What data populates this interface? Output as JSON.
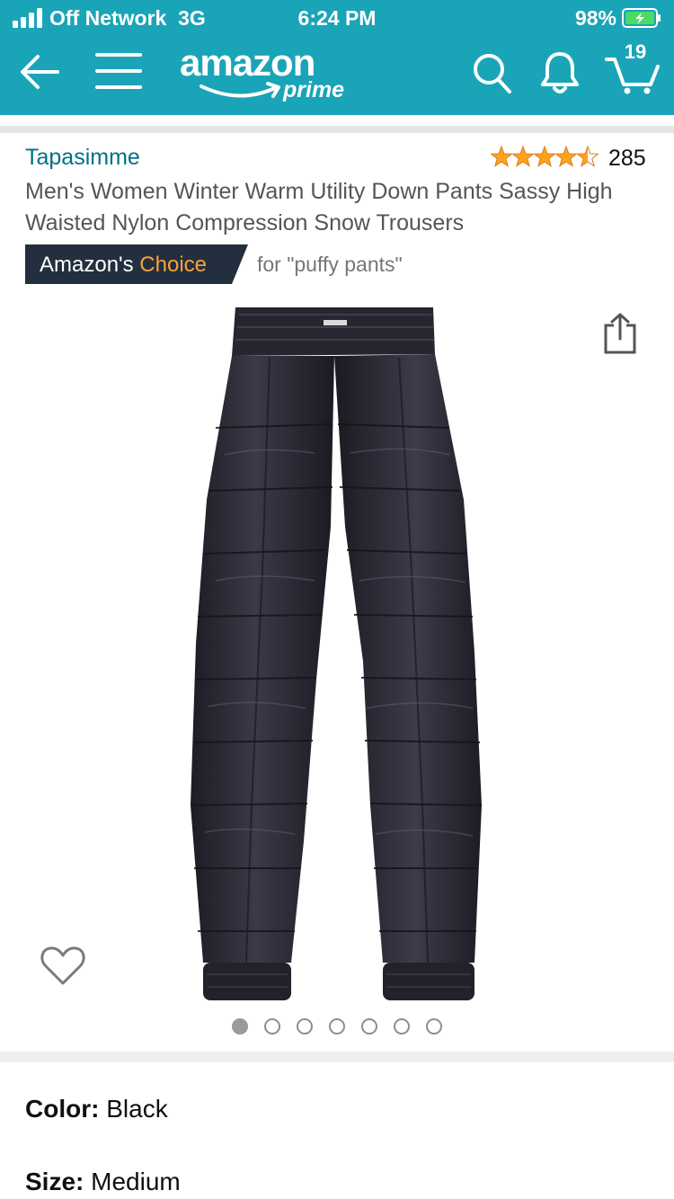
{
  "status_bar": {
    "network": "Off Network",
    "connection_type": "3G",
    "time": "6:24 PM",
    "battery_percent": "98%",
    "battery_charging": true,
    "signal_bars": 4
  },
  "header": {
    "logo_word": "amazon",
    "logo_sub": "prime",
    "cart_count": "19",
    "icons": [
      "back-arrow-icon",
      "menu-icon",
      "search-icon",
      "bell-icon",
      "cart-icon"
    ],
    "background_color": "#1aa4b8"
  },
  "product": {
    "brand": "Tapasimme",
    "rating_stars": 4.5,
    "rating_count": "285",
    "title": "Men's Women Winter Warm Utility Down Pants Sassy High Waisted Nylon Compression Snow Trousers",
    "badge": {
      "prefix": "Amazon's",
      "highlight": "Choice",
      "keyword": "for \"puffy pants\""
    },
    "image_dots": {
      "total": 7,
      "active_index": 0
    },
    "color": {
      "label": "Color:",
      "value": "Black"
    },
    "size": {
      "label": "Size:",
      "value": "Medium"
    }
  },
  "colors": {
    "accent_teal": "#1aa4b8",
    "link": "#007185",
    "star": "#ffa41c",
    "badge_bg": "#232f3e",
    "badge_highlight": "#f7a23b"
  }
}
